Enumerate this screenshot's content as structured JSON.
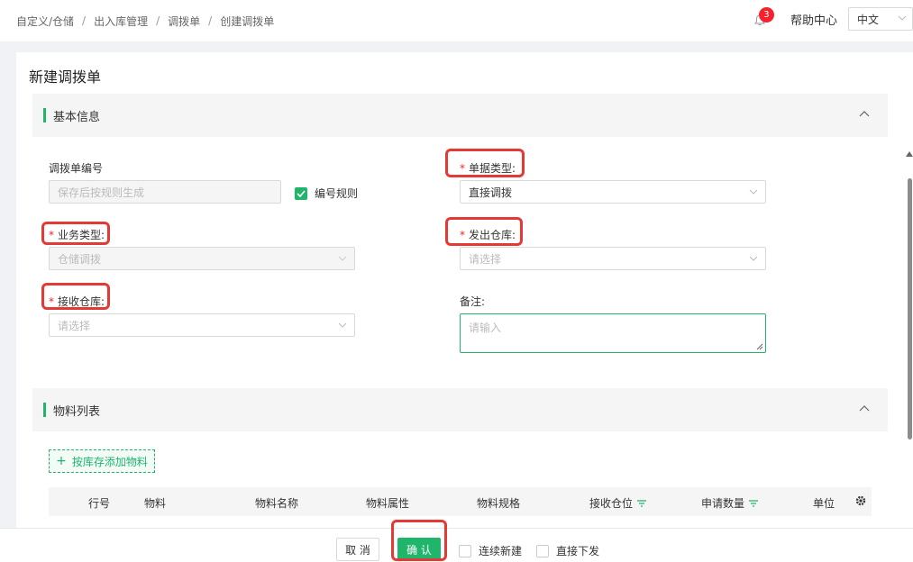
{
  "breadcrumb": [
    "自定义/仓储",
    "出入库管理",
    "调拨单",
    "创建调拨单"
  ],
  "header": {
    "notification_count": "3",
    "help_label": "帮助中心",
    "language": "中文"
  },
  "page_title": "新建调拨单",
  "basic_info": {
    "title": "基本信息",
    "doc_no": {
      "label": "调拨单编号",
      "placeholder": "保存后按规则生成"
    },
    "numbering_rule": {
      "label": "编号规则",
      "checked": true
    },
    "doc_type": {
      "label": "单据类型:",
      "value": "直接调拨"
    },
    "business_type": {
      "label": "业务类型:",
      "value": "仓储调拨"
    },
    "source_warehouse": {
      "label": "发出仓库:",
      "placeholder": "请选择"
    },
    "target_warehouse": {
      "label": "接收仓库:",
      "placeholder": "请选择"
    },
    "remark": {
      "label": "备注:",
      "placeholder": "请输入"
    }
  },
  "material_list": {
    "title": "物料列表",
    "add_button": "按库存添加物料",
    "columns": [
      "行号",
      "物料",
      "物料名称",
      "物料属性",
      "物料规格",
      "接收仓位",
      "申请数量",
      "单位"
    ]
  },
  "footer": {
    "cancel": "取 消",
    "confirm": "确 认",
    "continue_new": "连续新建",
    "direct_issue": "直接下发"
  },
  "colors": {
    "accent": "#1fb56b",
    "required": "#f5222d",
    "highlight": "#e53935"
  }
}
